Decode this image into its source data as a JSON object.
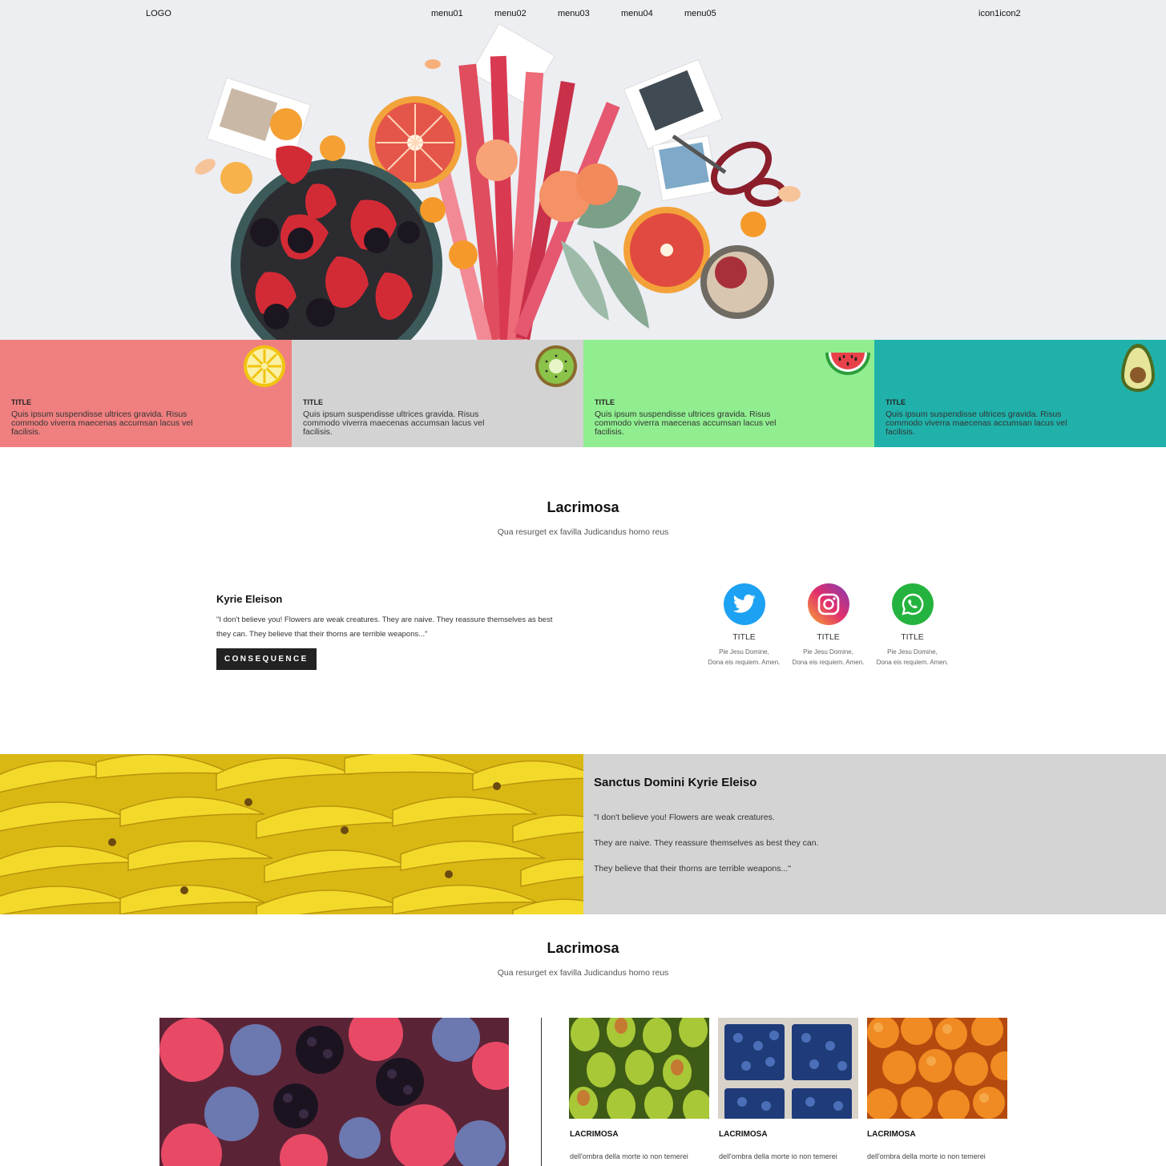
{
  "nav": {
    "logo": "LOGO",
    "menus": [
      "menu01",
      "menu02",
      "menu03",
      "menu04",
      "menu05"
    ],
    "icons": "icon1icon2"
  },
  "cards": [
    {
      "title": "TITLE",
      "text": "Quis ipsum suspendisse ultrices gravida. Risus commodo viverra maecenas accumsan lacus vel facilisis.",
      "color": "#f08080",
      "icon": "lemon-icon"
    },
    {
      "title": "TITLE",
      "text": "Quis ipsum suspendisse ultrices gravida. Risus commodo viverra maecenas accumsan lacus vel facilisis.",
      "color": "#d3d3d3",
      "icon": "kiwi-icon"
    },
    {
      "title": "TITLE",
      "text": "Quis ipsum suspendisse ultrices gravida. Risus commodo viverra maecenas accumsan lacus vel facilisis.",
      "color": "#90ee90",
      "icon": "watermelon-icon"
    },
    {
      "title": "TITLE",
      "text": "Quis ipsum suspendisse ultrices gravida. Risus commodo viverra maecenas accumsan lacus vel facilisis.",
      "color": "#20b2aa",
      "icon": "avocado-icon"
    }
  ],
  "section1": {
    "title": "Lacrimosa",
    "subtitle": "Qua resurget ex favilla Judicandus homo reus"
  },
  "quote": {
    "heading": "Kyrie Eleison",
    "text": "\"I don't believe you! Flowers are weak creatures. They are naive. They reassure themselves as best they can. They believe that their thorns are terrible weapons...\"",
    "button": "CONSEQUENCE"
  },
  "socials": [
    {
      "title": "TITLE",
      "line1": "Pie Jesu Domine,",
      "line2": "Dona eis requiem. Amen.",
      "icon": "twitter-icon",
      "color": "#1da1f2"
    },
    {
      "title": "TITLE",
      "line1": "Pie Jesu Domine,",
      "line2": "Dona eis requiem. Amen.",
      "icon": "instagram-icon",
      "color": "#c13584"
    },
    {
      "title": "TITLE",
      "line1": "Pie Jesu Domine,",
      "line2": "Dona eis requiem. Amen.",
      "icon": "whatsapp-icon",
      "color": "#25b33f"
    }
  ],
  "feature": {
    "heading": "Sanctus Domini Kyrie Eleiso",
    "lines": [
      "\"I don't believe you! Flowers are weak creatures.",
      "They are naive. They reassure themselves as best they can.",
      "They believe that their thorns are terrible weapons...\""
    ]
  },
  "section2": {
    "title": "Lacrimosa",
    "subtitle": "Qua resurget ex favilla Judicandus homo reus"
  },
  "gallery": [
    {
      "label": "LACRIMOSA",
      "desc": "dell'ombra della morte io non temerei"
    },
    {
      "label": "LACRIMOSA",
      "desc": "dell'ombra della morte io non temerei"
    },
    {
      "label": "LACRIMOSA",
      "desc": "dell'ombra della morte io non temerei"
    }
  ]
}
